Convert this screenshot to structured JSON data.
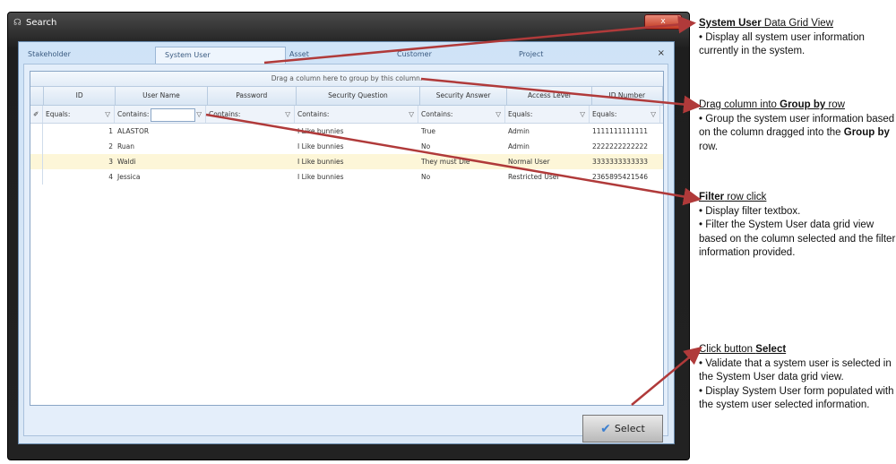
{
  "window": {
    "title": "Search",
    "close": "x"
  },
  "tabs": [
    "Stakeholder",
    "System User",
    "Asset",
    "Customer",
    "Project"
  ],
  "tab_close": "×",
  "grid": {
    "group_hint": "Drag a column here to group by this column.",
    "columns": [
      "ID",
      "User Name",
      "Password",
      "Security Question",
      "Security Answer",
      "Access Level",
      "ID Number"
    ],
    "filters": [
      "Equals:",
      "Contains:",
      "Contains:",
      "Contains:",
      "Contains:",
      "Equals:",
      "Equals:"
    ],
    "rows": [
      [
        "1",
        "ALASTOR",
        "",
        "I Like bunnies",
        "True",
        "Admin",
        "1111111111111"
      ],
      [
        "2",
        "Ruan",
        "",
        "I Like bunnies",
        "No",
        "Admin",
        "2222222222222"
      ],
      [
        "3",
        "Waldi",
        "",
        "I Like bunnies",
        "They must Die",
        "Normal User",
        "3333333333333"
      ],
      [
        "4",
        "Jessica",
        "",
        "I Like bunnies",
        "No",
        "Restricted User",
        "2365895421546"
      ]
    ]
  },
  "select_button": "Select",
  "annotations": {
    "a1": {
      "title_bold": "System User",
      "title_rest": " Data Grid View",
      "lines": [
        "• Display all system user information currently in the system."
      ]
    },
    "a2": {
      "title_pre": "Drag column into ",
      "title_bold": "Group by",
      "title_rest": " row",
      "line_pre": "• Group the system user information based on the column dragged into the ",
      "line_bold": "Group  by",
      "line_post": " row."
    },
    "a3": {
      "title_bold": "Filter",
      "title_rest": " row click",
      "lines": [
        "• Display filter textbox.",
        "• Filter the System User data grid view based on the column selected and the filter information provided."
      ]
    },
    "a4": {
      "title_pre": "Click button ",
      "title_bold": "Select",
      "lines": [
        "• Validate that a system user is selected in the System User data grid view.",
        "• Display System User form populated with the system user selected information."
      ]
    }
  },
  "colors": {
    "arrow": "#b03a3a",
    "selected_row": "#fdf6d8"
  }
}
